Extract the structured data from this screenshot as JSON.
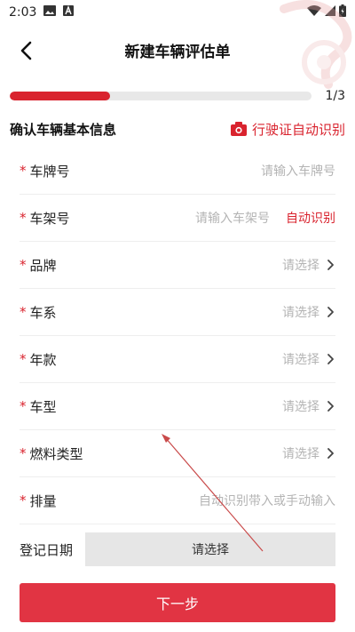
{
  "status": {
    "time": "2:03"
  },
  "nav": {
    "title": "新建车辆评估单"
  },
  "progress": {
    "text": "1/3",
    "fraction": 0.333
  },
  "section": {
    "title": "确认车辆基本信息",
    "ocr_label": "行驶证自动识别"
  },
  "form": {
    "required_mark": "*",
    "fields": [
      {
        "label": "车牌号",
        "placeholder": "请输入车牌号"
      },
      {
        "label": "车架号",
        "placeholder": "请输入车架号",
        "action": "自动识别"
      },
      {
        "label": "品牌",
        "placeholder": "请选择"
      },
      {
        "label": "车系",
        "placeholder": "请选择"
      },
      {
        "label": "年款",
        "placeholder": "请选择"
      },
      {
        "label": "车型",
        "placeholder": "请选择"
      },
      {
        "label": "燃料类型",
        "placeholder": "请选择"
      },
      {
        "label": "排量",
        "placeholder": "自动识别带入或手动输入"
      }
    ],
    "date": {
      "label": "登记日期",
      "value": "请选择"
    }
  },
  "button": {
    "next": "下一步"
  },
  "colors": {
    "accent": "#d9232e",
    "button": "#e13443"
  },
  "icons": {
    "back": "chevron-left-icon",
    "camera": "camera-icon",
    "chevron": "chevron-right-icon"
  }
}
